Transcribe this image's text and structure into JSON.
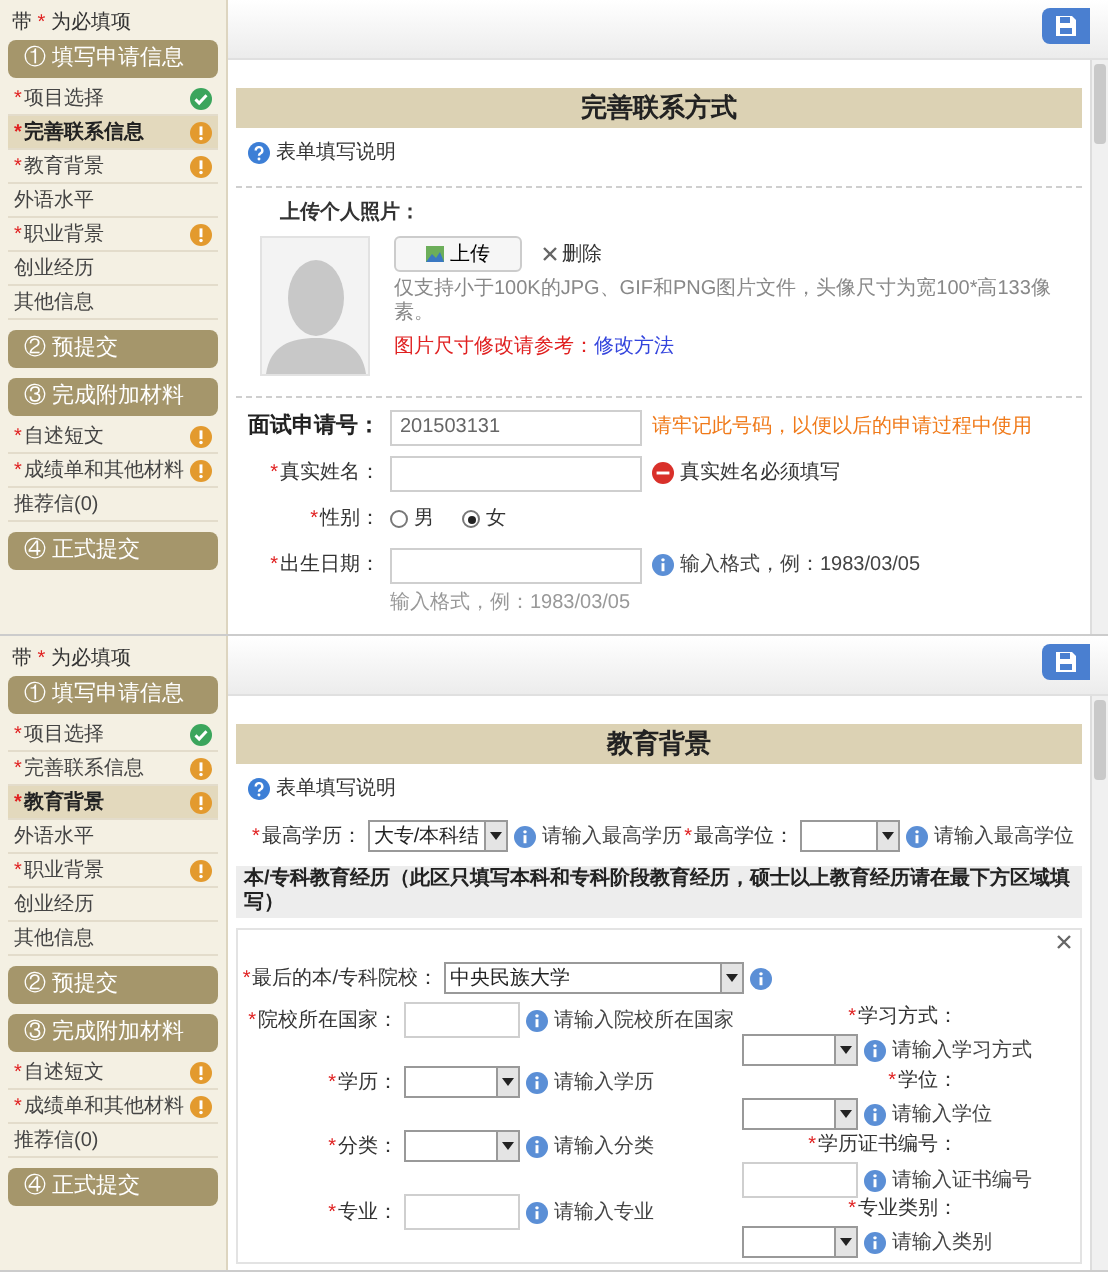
{
  "screens": [
    {
      "legend": {
        "prefix": "带",
        "mark": "*",
        "text": "为必填项"
      },
      "sidebar": [
        {
          "title": "① 填写申请信息",
          "items": [
            {
              "mark": "*",
              "label": "项目选择",
              "selected": false,
              "kind": "done"
            },
            {
              "mark": "*",
              "label": "完善联系信息",
              "selected": true,
              "kind": "pending"
            },
            {
              "mark": "*",
              "label": "教育背景",
              "selected": false,
              "kind": "pending"
            },
            {
              "label": "外语水平",
              "selected": false
            },
            {
              "mark": "*",
              "label": "职业背景",
              "selected": false,
              "kind": "pending"
            },
            {
              "label": "创业经历",
              "selected": false
            },
            {
              "label": "其他信息",
              "selected": false
            }
          ]
        },
        {
          "title": "② 预提交"
        },
        {
          "title": "③ 完成附加材料",
          "items": [
            {
              "mark": "*",
              "label": "自述短文",
              "selected": false,
              "kind": "pending"
            },
            {
              "mark": "*",
              "label": "成绩单和其他材料",
              "selected": false,
              "kind": "pending"
            },
            {
              "label": "推荐信(0)",
              "selected": false
            }
          ]
        },
        {
          "title": "④ 正式提交"
        }
      ],
      "page": {
        "kind": "contact",
        "title": "完善联系方式",
        "help": "表单填写说明",
        "photo": {
          "label": "上传个人照片：",
          "upload": "上传",
          "delete": "删除",
          "requirements": "仅支持小于100K的JPG、GIF和PNG图片文件，头像尺寸为宽100*高133像素。",
          "resize_note": "图片尺寸修改请参考：",
          "resize_link": "修改方法"
        },
        "fields": [
          {
            "label": "面试申请号：",
            "strong": true,
            "kind": "input",
            "value": "201503131",
            "hint": {
              "kind": "note",
              "text": "请牢记此号码，以便以后的申请过程中使用"
            }
          },
          {
            "mark": "*",
            "label": "真实姓名：",
            "kind": "input",
            "hint": {
              "kind": "error",
              "text": "真实姓名必须填写"
            }
          },
          {
            "mark": "*",
            "label": "性别：",
            "kind": "radio",
            "options": [
              {
                "label": "男",
                "selected": false
              },
              {
                "label": "女",
                "selected": true
              }
            ]
          },
          {
            "mark": "*",
            "label": "出生日期：",
            "kind": "input",
            "hint": {
              "kind": "info",
              "text": "输入格式，例：1983/03/05"
            },
            "below": "输入格式，例：1983/03/05"
          }
        ]
      }
    },
    {
      "legend": {
        "prefix": "带",
        "mark": "*",
        "text": "为必填项"
      },
      "sidebar": [
        {
          "title": "① 填写申请信息",
          "items": [
            {
              "mark": "*",
              "label": "项目选择",
              "selected": false,
              "kind": "done"
            },
            {
              "mark": "*",
              "label": "完善联系信息",
              "selected": false,
              "kind": "pending"
            },
            {
              "mark": "*",
              "label": "教育背景",
              "selected": true,
              "kind": "pending"
            },
            {
              "label": "外语水平",
              "selected": false
            },
            {
              "mark": "*",
              "label": "职业背景",
              "selected": false,
              "kind": "pending"
            },
            {
              "label": "创业经历",
              "selected": false
            },
            {
              "label": "其他信息",
              "selected": false
            }
          ]
        },
        {
          "title": "② 预提交"
        },
        {
          "title": "③ 完成附加材料",
          "items": [
            {
              "mark": "*",
              "label": "自述短文",
              "selected": false,
              "kind": "pending"
            },
            {
              "mark": "*",
              "label": "成绩单和其他材料",
              "selected": false,
              "kind": "pending"
            },
            {
              "label": "推荐信(0)",
              "selected": false
            }
          ]
        },
        {
          "title": "④ 正式提交"
        }
      ],
      "page": {
        "kind": "education",
        "title": "教育背景",
        "help": "表单填写说明",
        "top_fields": [
          {
            "mark": "*",
            "label": "最高学历：",
            "kind": "select",
            "value": "大专/本科结",
            "hint": {
              "kind": "info",
              "text": "请输入最高学历"
            }
          },
          {
            "mark": "*",
            "label": "最高学位：",
            "kind": "select",
            "hint": {
              "kind": "info",
              "text": "请输入最高学位"
            }
          }
        ],
        "section": "本/专科教育经历（此区只填写本科和专科阶段教育经历，硕士以上教育经历请在最下方区域填写）",
        "card": {
          "closable": true,
          "rows": [
            {
              "left": {
                "mark": "*",
                "label": "最后的本/专科院校：",
                "kind": "select",
                "value": "中央民族大学",
                "hint": {
                  "kind": "info"
                }
              }
            },
            {
              "left": {
                "mark": "*",
                "label": "院校所在国家：",
                "kind": "input",
                "hint": {
                  "kind": "info",
                  "text": "请输入院校所在国家"
                }
              },
              "right": {
                "mark": "*",
                "label": "学习方式：",
                "kind": "select",
                "hint": {
                  "kind": "info",
                  "text": "请输入学习方式"
                }
              }
            },
            {
              "left": {
                "mark": "*",
                "label": "学历：",
                "kind": "select",
                "hint": {
                  "kind": "info",
                  "text": "请输入学历"
                }
              },
              "right": {
                "mark": "*",
                "label": "学位：",
                "kind": "select",
                "hint": {
                  "kind": "info",
                  "text": "请输入学位"
                }
              }
            },
            {
              "left": {
                "mark": "*",
                "label": "分类：",
                "kind": "select",
                "hint": {
                  "kind": "info",
                  "text": "请输入分类"
                }
              },
              "right": {
                "mark": "*",
                "label": "学历证书编号：",
                "kind": "input",
                "hint": {
                  "kind": "info",
                  "text": "请输入证书编号"
                }
              }
            },
            {
              "left": {
                "mark": "*",
                "label": "专业：",
                "kind": "input",
                "hint": {
                  "kind": "info",
                  "text": "请输入专业"
                }
              },
              "right": {
                "mark": "*",
                "label": "专业类别：",
                "kind": "select",
                "hint": {
                  "kind": "info",
                  "text": "请输入类别"
                }
              }
            }
          ]
        }
      }
    }
  ]
}
